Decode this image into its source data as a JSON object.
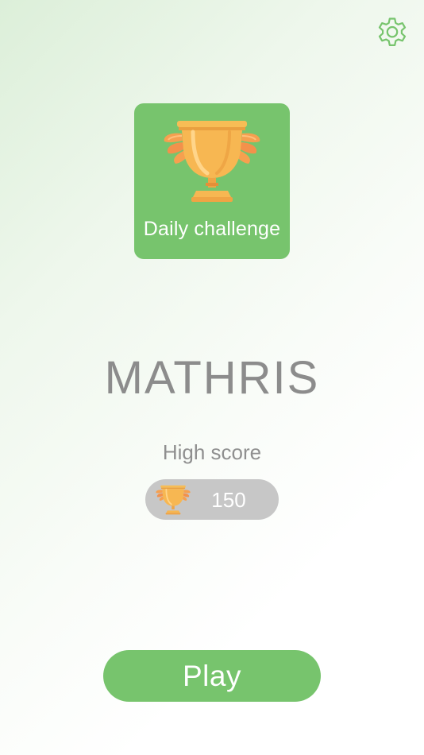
{
  "header": {
    "settings_icon": "gear-icon",
    "icon_color": "#77c46d"
  },
  "daily_challenge": {
    "label": "Daily challenge",
    "icon": "winged-trophy-icon",
    "background": "#77c46d"
  },
  "app": {
    "title": "MATHRIS"
  },
  "high_score": {
    "label": "High score",
    "icon": "winged-trophy-icon",
    "value": "150"
  },
  "play": {
    "label": "Play",
    "background": "#77c46d"
  }
}
